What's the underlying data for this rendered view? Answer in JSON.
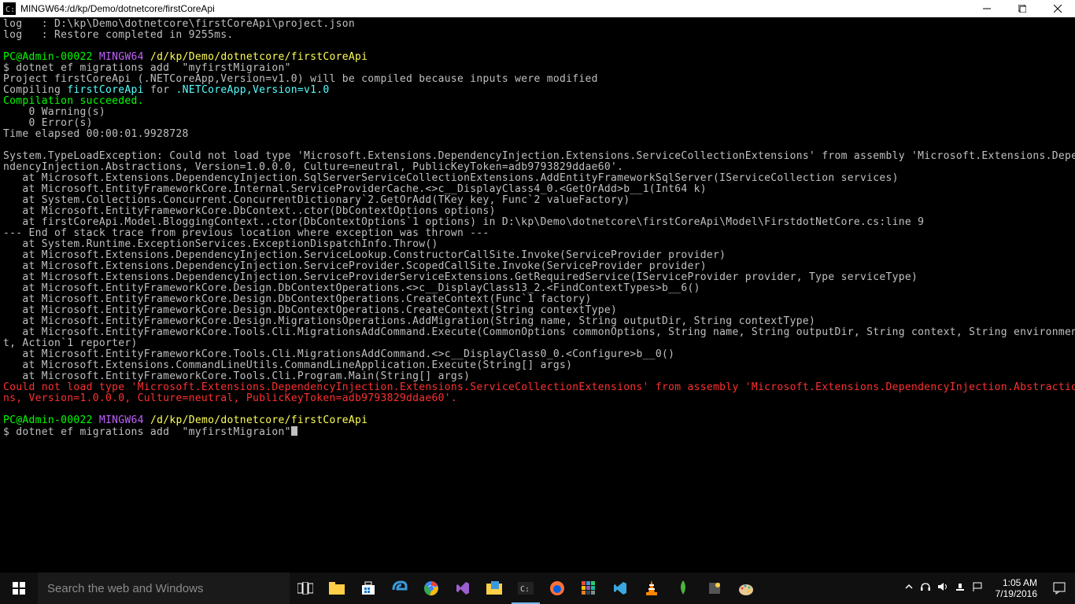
{
  "titlebar": {
    "title": "MINGW64:/d/kp/Demo/dotnetcore/firstCoreApi"
  },
  "terminal": {
    "log1": "log   : D:\\kp\\Demo\\dotnetcore\\firstCoreApi\\project.json",
    "log2": "log   : Restore completed in 9255ms.",
    "prompt1_user": "PC@Admin-00022",
    "prompt1_sys": "MINGW64",
    "prompt1_path": "/d/kp/Demo/dotnetcore/firstCoreApi",
    "cmd1": "$ dotnet ef migrations add  \"myfirstMigraion\"",
    "build1": "Project firstCoreApi (.NETCoreApp,Version=v1.0) will be compiled because inputs were modified",
    "build2a": "Compiling ",
    "build2b": "firstCoreApi",
    "build2c": " for ",
    "build2d": ".NETCoreApp,Version=v1.0",
    "succ": "Compilation succeeded.",
    "warn": "    0 Warning(s)",
    "err": "    0 Error(s)",
    "elapsed": "Time elapsed 00:00:01.9928728",
    "ex1": "System.TypeLoadException: Could not load type 'Microsoft.Extensions.DependencyInjection.Extensions.ServiceCollectionExtensions' from assembly 'Microsoft.Extensions.Depe",
    "ex2": "ndencyInjection.Abstractions, Version=1.0.0.0, Culture=neutral, PublicKeyToken=adb9793829ddae60'.",
    "st01": "   at Microsoft.Extensions.DependencyInjection.SqlServerServiceCollectionExtensions.AddEntityFrameworkSqlServer(IServiceCollection services)",
    "st02": "   at Microsoft.EntityFrameworkCore.Internal.ServiceProviderCache.<>c__DisplayClass4_0.<GetOrAdd>b__1(Int64 k)",
    "st03": "   at System.Collections.Concurrent.ConcurrentDictionary`2.GetOrAdd(TKey key, Func`2 valueFactory)",
    "st04": "   at Microsoft.EntityFrameworkCore.DbContext..ctor(DbContextOptions options)",
    "st05": "   at firstCoreApi.Model.BloggingContext..ctor(DbContextOptions`1 options) in D:\\kp\\Demo\\dotnetcore\\firstCoreApi\\Model\\FirstdotNetCore.cs:line 9",
    "st06": "--- End of stack trace from previous location where exception was thrown ---",
    "st07": "   at System.Runtime.ExceptionServices.ExceptionDispatchInfo.Throw()",
    "st08": "   at Microsoft.Extensions.DependencyInjection.ServiceLookup.ConstructorCallSite.Invoke(ServiceProvider provider)",
    "st09": "   at Microsoft.Extensions.DependencyInjection.ServiceProvider.ScopedCallSite.Invoke(ServiceProvider provider)",
    "st10": "   at Microsoft.Extensions.DependencyInjection.ServiceProviderServiceExtensions.GetRequiredService(IServiceProvider provider, Type serviceType)",
    "st11": "   at Microsoft.EntityFrameworkCore.Design.DbContextOperations.<>c__DisplayClass13_2.<FindContextTypes>b__6()",
    "st12": "   at Microsoft.EntityFrameworkCore.Design.DbContextOperations.CreateContext(Func`1 factory)",
    "st13": "   at Microsoft.EntityFrameworkCore.Design.DbContextOperations.CreateContext(String contextType)",
    "st14": "   at Microsoft.EntityFrameworkCore.Design.MigrationsOperations.AddMigration(String name, String outputDir, String contextType)",
    "st15": "   at Microsoft.EntityFrameworkCore.Tools.Cli.MigrationsAddCommand.Execute(CommonOptions commonOptions, String name, String outputDir, String context, String environmen",
    "st16": "t, Action`1 reporter)",
    "st17": "   at Microsoft.EntityFrameworkCore.Tools.Cli.MigrationsAddCommand.<>c__DisplayClass0_0.<Configure>b__0()",
    "st18": "   at Microsoft.Extensions.CommandLineUtils.CommandLineApplication.Execute(String[] args)",
    "st19": "   at Microsoft.EntityFrameworkCore.Tools.Cli.Program.Main(String[] args)",
    "red1": "Could not load type 'Microsoft.Extensions.DependencyInjection.Extensions.ServiceCollectionExtensions' from assembly 'Microsoft.Extensions.DependencyInjection.Abstractio",
    "red2": "ns, Version=1.0.0.0, Culture=neutral, PublicKeyToken=adb9793829ddae60'.",
    "prompt2_user": "PC@Admin-00022",
    "prompt2_sys": "MINGW64",
    "prompt2_path": "/d/kp/Demo/dotnetcore/firstCoreApi",
    "cmd2": "$ dotnet ef migrations add  \"myfirstMigraion\""
  },
  "taskbar": {
    "search_placeholder": "Search the web and Windows",
    "clock_time": "1:05 AM",
    "clock_date": "7/19/2016"
  }
}
